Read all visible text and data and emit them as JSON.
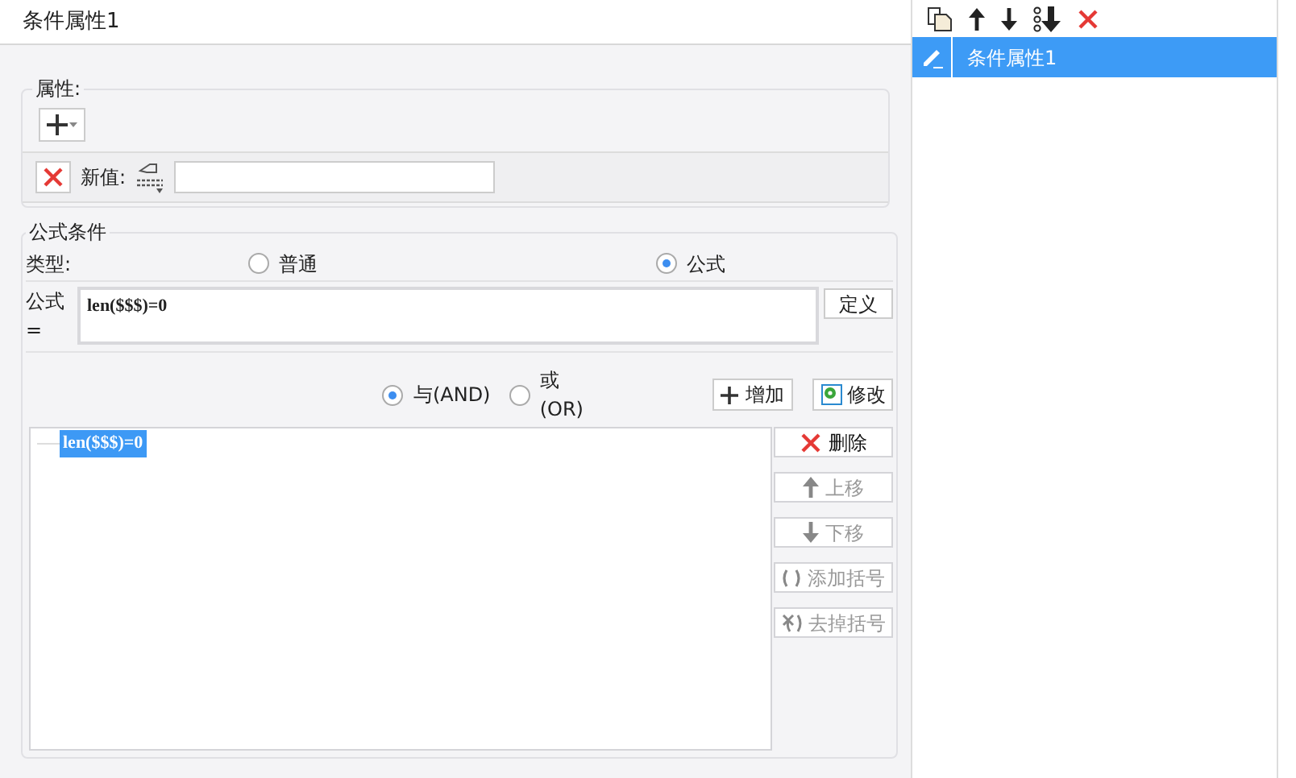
{
  "title": "条件属性1",
  "attributes": {
    "legend": "属性:",
    "new_value_label": "新值:"
  },
  "formula_condition": {
    "legend": "公式条件",
    "type_label": "类型:",
    "types": [
      {
        "label": "普通",
        "selected": false
      },
      {
        "label": "公式",
        "selected": true
      }
    ],
    "formula_label": "公式=",
    "formula": "len($$$)=0",
    "define_button": "定义",
    "logic": [
      {
        "label": "与(AND)",
        "selected": true
      },
      {
        "label": "或(OR)",
        "selected": false
      }
    ],
    "add_button": "增加",
    "modify_button": "修改",
    "conditions": [
      {
        "text": "len($$$)=0",
        "selected": true
      }
    ],
    "actions": [
      {
        "kind": "delete",
        "label": "删除",
        "disabled": false
      },
      {
        "kind": "up",
        "label": "上移",
        "disabled": true
      },
      {
        "kind": "down",
        "label": "下移",
        "disabled": true
      },
      {
        "kind": "add-paren",
        "label": "添加括号",
        "disabled": true
      },
      {
        "kind": "remove-paren",
        "label": "去掉括号",
        "disabled": true
      }
    ]
  },
  "sidebar": {
    "items": [
      {
        "label": "条件属性1",
        "selected": true
      }
    ]
  }
}
